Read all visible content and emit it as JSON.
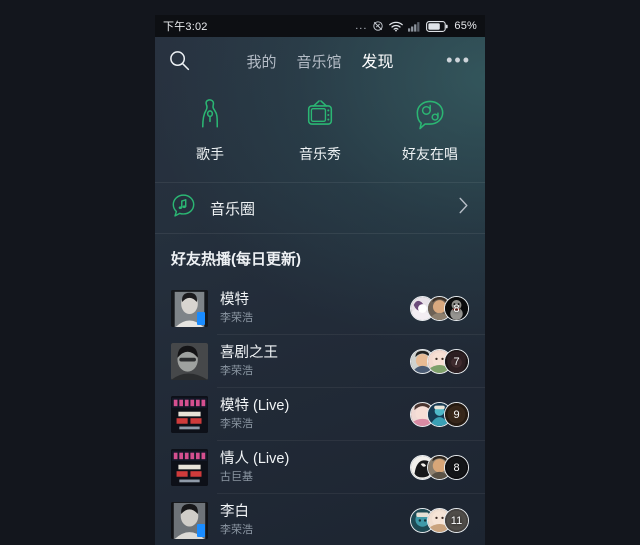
{
  "statusbar": {
    "time": "下午3:02",
    "dots": "...",
    "battery_percent": "65%",
    "icons": [
      "more-dots-icon",
      "silent-mode-icon",
      "wifi-icon",
      "cellular-signal-icon",
      "battery-icon"
    ]
  },
  "navbar": {
    "search_icon": "search-icon",
    "more_icon": "more-options-icon",
    "more_label": "•••",
    "tabs": [
      {
        "label": "我的",
        "active": false
      },
      {
        "label": "音乐馆",
        "active": false
      },
      {
        "label": "发现",
        "active": true
      }
    ]
  },
  "entries": [
    {
      "label": "歌手",
      "icon": "singer-microphone-icon"
    },
    {
      "label": "音乐秀",
      "icon": "tv-music-show-icon"
    },
    {
      "label": "好友在唱",
      "icon": "friends-singing-icon"
    }
  ],
  "music_circle": {
    "label": "音乐圈",
    "icon": "music-note-bubble-icon",
    "chevron": "chevron-right-icon"
  },
  "section": {
    "title": "好友热播(每日更新)"
  },
  "songs": [
    {
      "title": "模特",
      "artist": "李荣浩",
      "count": "8",
      "cover": "portrait-bw-man",
      "has_tag": true,
      "avatars": [
        "avatar-white-cat",
        "avatar-man-smiling",
        "avatar-cartoon-dark"
      ]
    },
    {
      "title": "喜剧之王",
      "artist": "李荣浩",
      "count": "7",
      "cover": "portrait-bw-glasses",
      "has_tag": false,
      "avatars": [
        "avatar-boy",
        "avatar-pink-face",
        "avatar-dark-girl"
      ]
    },
    {
      "title": "模特 (Live)",
      "artist": "李荣浩",
      "count": "9",
      "cover": "concert-poster",
      "has_tag": false,
      "avatars": [
        "avatar-girl-pink",
        "avatar-teal-figure",
        "avatar-brown"
      ]
    },
    {
      "title": "情人 (Live)",
      "artist": "古巨基",
      "count": "8",
      "cover": "concert-poster",
      "has_tag": false,
      "avatars": [
        "avatar-bw-shape",
        "avatar-man-face",
        "avatar-dark-circle"
      ]
    },
    {
      "title": "李白",
      "artist": "李荣浩",
      "count": "11",
      "cover": "portrait-bw-man2",
      "has_tag": true,
      "avatars": [
        "avatar-teal-char",
        "avatar-peach-face",
        "avatar-grey"
      ]
    }
  ],
  "colors": {
    "accent_green": "#2bb673",
    "bg_dark": "#13161d",
    "panel_top": "#28313f",
    "panel_bottom": "#1d2531",
    "text_primary": "#f2f5f7",
    "text_secondary": "#8c97a3",
    "tag_blue": "#1a8cff"
  }
}
